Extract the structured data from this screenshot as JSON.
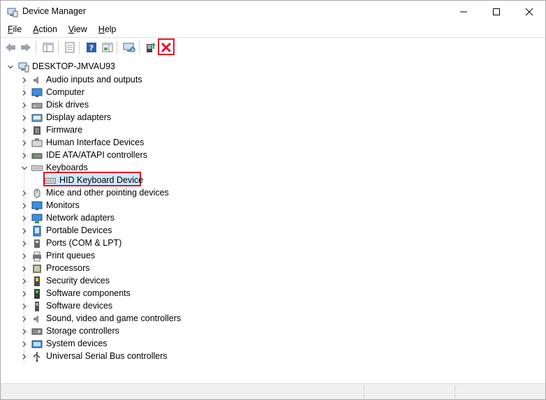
{
  "window": {
    "title": "Device Manager"
  },
  "menu": [
    {
      "label": "File",
      "accel": "F",
      "rest": "ile"
    },
    {
      "label": "Action",
      "accel": "A",
      "rest": "ction"
    },
    {
      "label": "View",
      "accel": "V",
      "rest": "iew"
    },
    {
      "label": "Help",
      "accel": "H",
      "rest": "elp"
    }
  ],
  "tree": {
    "root": "DESKTOP-JMVAU93",
    "categories": [
      {
        "label": "Audio inputs and outputs",
        "icon": "speaker-icon",
        "expanded": false
      },
      {
        "label": "Computer",
        "icon": "monitor-icon",
        "expanded": false
      },
      {
        "label": "Disk drives",
        "icon": "disk-drive-icon",
        "expanded": false
      },
      {
        "label": "Display adapters",
        "icon": "display-adapter-icon",
        "expanded": false
      },
      {
        "label": "Firmware",
        "icon": "chip-icon",
        "expanded": false
      },
      {
        "label": "Human Interface Devices",
        "icon": "hid-icon",
        "expanded": false
      },
      {
        "label": "IDE ATA/ATAPI controllers",
        "icon": "ide-controller-icon",
        "expanded": false
      },
      {
        "label": "Keyboards",
        "icon": "keyboard-icon",
        "expanded": true
      },
      {
        "label": "HID Keyboard Device",
        "icon": "keyboard-icon",
        "child": true,
        "selected": true
      },
      {
        "label": "Mice and other pointing devices",
        "icon": "mouse-icon",
        "expanded": false
      },
      {
        "label": "Monitors",
        "icon": "monitor-icon",
        "expanded": false
      },
      {
        "label": "Network adapters",
        "icon": "network-icon",
        "expanded": false
      },
      {
        "label": "Portable Devices",
        "icon": "portable-device-icon",
        "expanded": false
      },
      {
        "label": "Ports (COM & LPT)",
        "icon": "port-icon",
        "expanded": false
      },
      {
        "label": "Print queues",
        "icon": "printer-icon",
        "expanded": false
      },
      {
        "label": "Processors",
        "icon": "processor-icon",
        "expanded": false
      },
      {
        "label": "Security devices",
        "icon": "security-icon",
        "expanded": false
      },
      {
        "label": "Software components",
        "icon": "software-component-icon",
        "expanded": false
      },
      {
        "label": "Software devices",
        "icon": "software-device-icon",
        "expanded": false
      },
      {
        "label": "Sound, video and game controllers",
        "icon": "speaker-icon",
        "expanded": false
      },
      {
        "label": "Storage controllers",
        "icon": "storage-controller-icon",
        "expanded": false
      },
      {
        "label": "System devices",
        "icon": "system-device-icon",
        "expanded": false
      },
      {
        "label": "Universal Serial Bus controllers",
        "icon": "usb-icon",
        "expanded": false
      }
    ]
  },
  "colors": {
    "highlight_border": "#e81123",
    "selection": "#cce8ff"
  }
}
